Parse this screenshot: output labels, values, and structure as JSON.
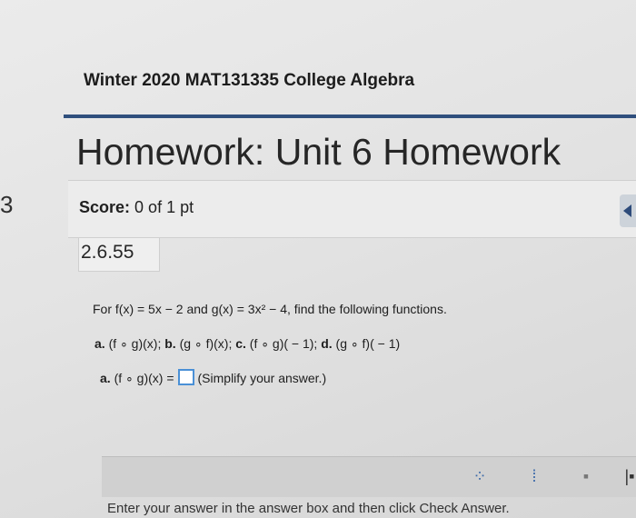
{
  "course": {
    "title": "Winter 2020 MAT131335 College Algebra"
  },
  "homework": {
    "title": "Homework: Unit 6 Homework"
  },
  "side_mark": "3",
  "score": {
    "label": "Score:",
    "value": "0 of 1 pt"
  },
  "question": {
    "id": "2.6.55",
    "line1": "For f(x) = 5x − 2 and g(x) = 3x² − 4, find the following functions.",
    "line2_a": "a.",
    "line2_a_text": " (f ∘ g)(x); ",
    "line2_b": "b.",
    "line2_b_text": " (g ∘ f)(x); ",
    "line2_c": "c.",
    "line2_c_text": " (f ∘ g)( − 1); ",
    "line2_d": "d.",
    "line2_d_text": " (g ∘ f)( − 1)",
    "part_label": "a.",
    "part_expr": " (f ∘ g)(x) =",
    "part_hint": "(Simplify your answer.)"
  },
  "toolbar": {
    "buttons": [
      {
        "icon": "fraction-icon",
        "glyph": "⁘"
      },
      {
        "icon": "mixed-number-icon",
        "glyph": "⁞"
      },
      {
        "icon": "exponent-icon",
        "glyph": "▪"
      },
      {
        "icon": "absolute-value-icon",
        "glyph": "|▪"
      }
    ]
  },
  "footer": {
    "text": "Enter your answer in the answer box and then click Check Answer."
  },
  "colors": {
    "accent": "#2f4f7d",
    "answer_box": "#4a90d6"
  }
}
